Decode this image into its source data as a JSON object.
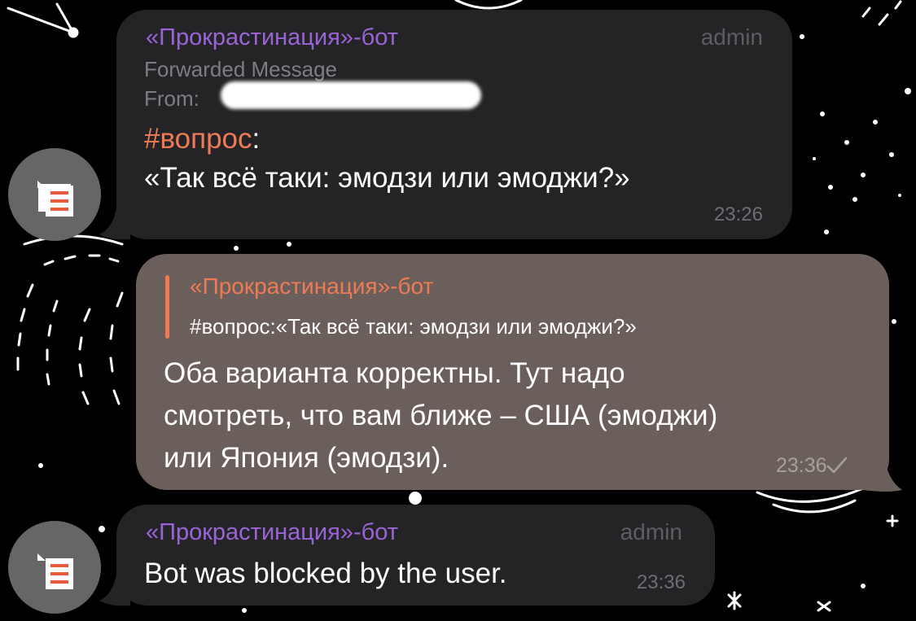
{
  "messages": [
    {
      "sender": "«Прокрастинация»-бот",
      "role": "admin",
      "forwarded_label": "Forwarded Message",
      "from_label": "From:",
      "hashtag": "#вопрос",
      "hashtag_suffix": ":",
      "text": "«Так всё таки: эмодзи или эмоджи?»",
      "time": "23:26",
      "avatar_icon": "bot-chat-icon"
    },
    {
      "reply": {
        "name": "«Прокрастинация»-бот",
        "text": "#вопрос:«Так всё таки: эмодзи или эмоджи?»"
      },
      "lines": [
        "Оба варианта корректны. Тут надо",
        "смотреть, что вам ближе – США (эмоджи)",
        "или Япония (эмодзи)."
      ],
      "time": "23:36",
      "status_icon": "checkmark-icon"
    },
    {
      "sender": "«Прокрастинация»-бот",
      "role": "admin",
      "text": "Bot was blocked by the user.",
      "time": "23:36",
      "avatar_icon": "bot-chat-icon"
    }
  ],
  "colors": {
    "background": "#000000",
    "incoming_bubble": "#242426",
    "outgoing_bubble": "#6a5f5a",
    "sender_name": "#9a64d6",
    "accent": "#ee7b55"
  }
}
